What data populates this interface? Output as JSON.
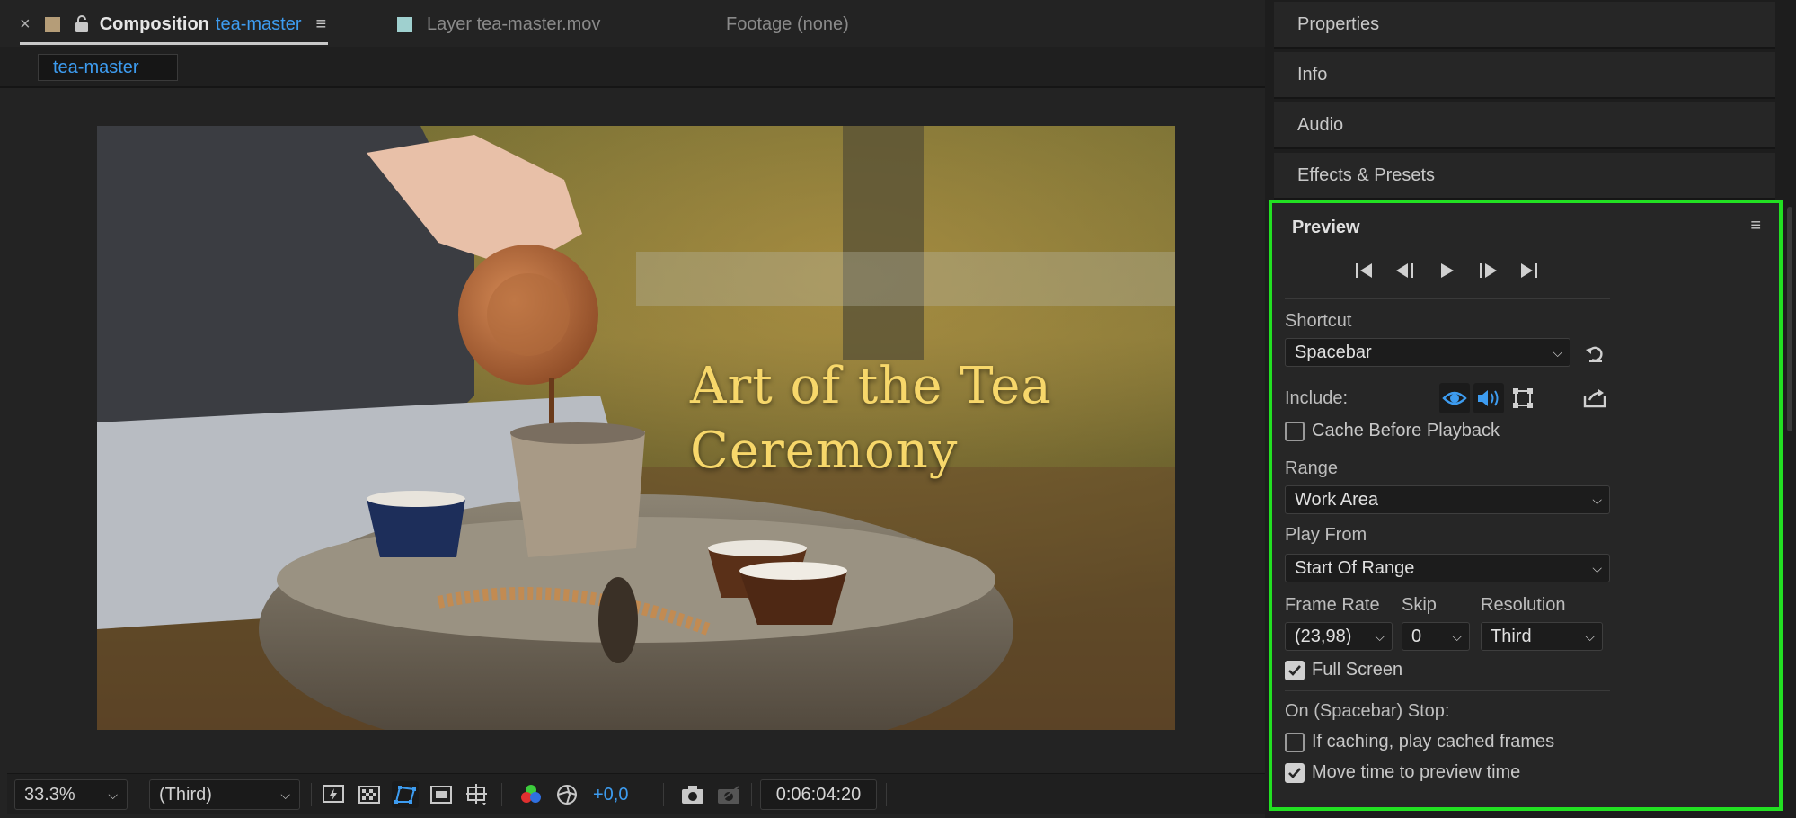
{
  "composition_panel": {
    "tabs": [
      {
        "label": "Composition",
        "accent": "tea-master"
      },
      {
        "label": "Layer",
        "name": "tea-master.mov"
      },
      {
        "label": "Footage (none)"
      }
    ],
    "close_glyph": "×",
    "menu_glyph": "≡",
    "subtab": "tea-master",
    "overlay_text": {
      "line1": "Art of the Tea",
      "line2": "Ceremony"
    },
    "footer": {
      "zoom": "33.3%",
      "resolution": "(Third)",
      "exposure": "+0,0",
      "timecode": "0:06:04:20"
    }
  },
  "right_panels": {
    "stack": [
      "Properties",
      "Info",
      "Audio",
      "Effects & Presets"
    ]
  },
  "preview": {
    "title": "Preview",
    "menu_glyph": "≡",
    "shortcut_label": "Shortcut",
    "shortcut_value": "Spacebar",
    "include_label": "Include:",
    "cache_before_playback": {
      "label": "Cache Before Playback",
      "checked": false
    },
    "range_label": "Range",
    "range_value": "Work Area",
    "play_from_label": "Play From",
    "play_from_value": "Start Of Range",
    "frame_rate_label": "Frame Rate",
    "frame_rate_value": "(23,98)",
    "skip_label": "Skip",
    "skip_value": "0",
    "resolution_label": "Resolution",
    "resolution_value": "Third",
    "full_screen": {
      "label": "Full Screen",
      "checked": true
    },
    "stop_label": "On (Spacebar) Stop:",
    "if_caching": {
      "label": "If caching, play cached frames",
      "checked": false
    },
    "move_time": {
      "label": "Move time to preview time",
      "checked": true
    }
  },
  "colors": {
    "accent_blue": "#3d9cf0",
    "highlight_green": "#22e022",
    "title_gold": "#f7d76a",
    "comp_swatch": "#b59d78",
    "layer_swatch": "#9fd0cf"
  }
}
